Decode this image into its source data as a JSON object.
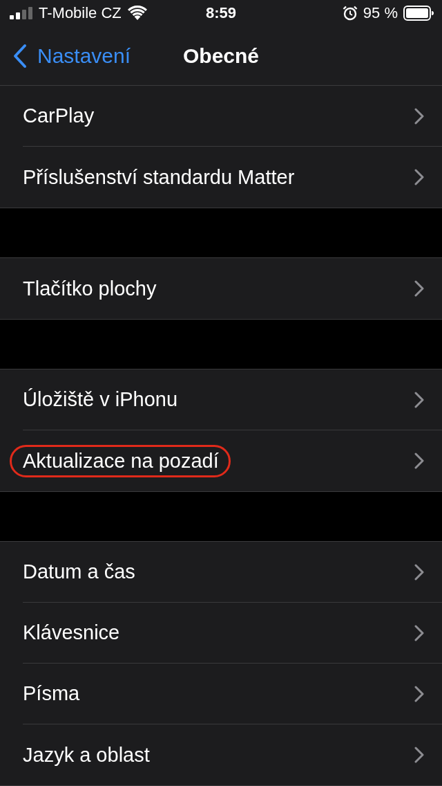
{
  "status_bar": {
    "carrier": "T-Mobile CZ",
    "time": "8:59",
    "battery": "95 %"
  },
  "nav": {
    "back": "Nastavení",
    "title": "Obecné"
  },
  "groups": [
    {
      "items": [
        {
          "label": "CarPlay",
          "highlighted": false
        },
        {
          "label": "Příslušenství standardu Matter",
          "highlighted": false
        }
      ]
    },
    {
      "items": [
        {
          "label": "Tlačítko plochy",
          "highlighted": false
        }
      ]
    },
    {
      "items": [
        {
          "label": "Úložiště v iPhonu",
          "highlighted": false
        },
        {
          "label": "Aktualizace na pozadí",
          "highlighted": true
        }
      ]
    },
    {
      "items": [
        {
          "label": "Datum a čas",
          "highlighted": false
        },
        {
          "label": "Klávesnice",
          "highlighted": false
        },
        {
          "label": "Písma",
          "highlighted": false
        },
        {
          "label": "Jazyk a oblast",
          "highlighted": false
        }
      ]
    }
  ]
}
